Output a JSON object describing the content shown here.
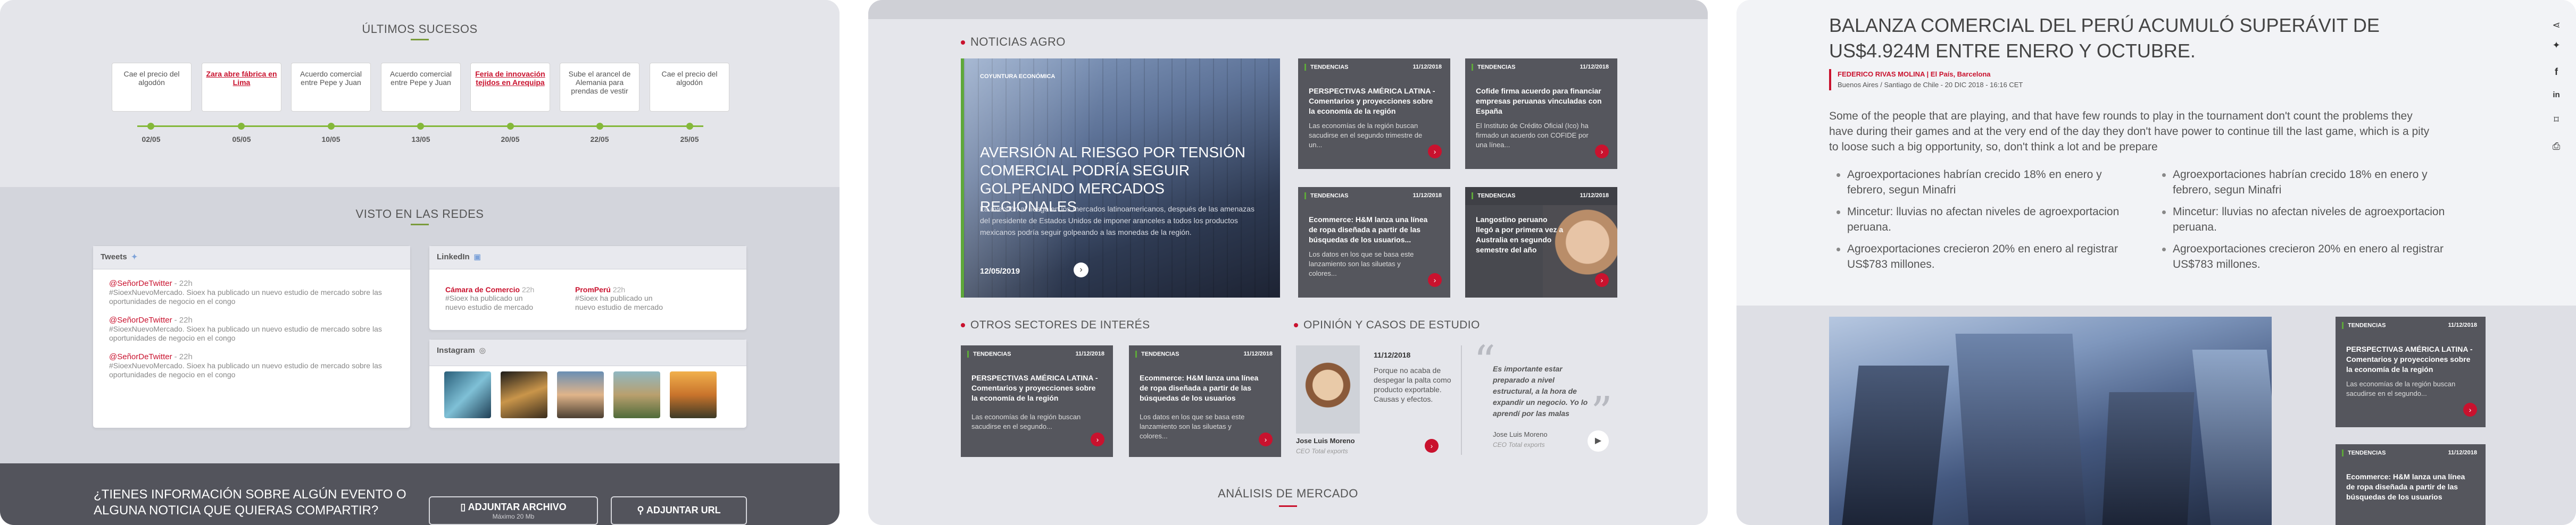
{
  "panel1": {
    "timeline_title": "ÚLTIMOS SUCESOS",
    "events": [
      {
        "label": "Cae el precio del algodón",
        "date": "02/05",
        "highlight": false
      },
      {
        "label": "Zara abre fábrica en Lima",
        "date": "05/05",
        "highlight": true
      },
      {
        "label": "Acuerdo comercial entre Pepe y Juan",
        "date": "10/05",
        "highlight": false
      },
      {
        "label": "Acuerdo comercial entre Pepe y Juan",
        "date": "13/05",
        "highlight": false
      },
      {
        "label": "Feria de innovación tejidos en Arequipa",
        "date": "20/05",
        "highlight": true
      },
      {
        "label": "Sube el arancel de Alemania para prendas de vestir",
        "date": "22/05",
        "highlight": false
      },
      {
        "label": "Cae el precio del algodón",
        "date": "25/05",
        "highlight": false
      }
    ],
    "social_title": "VISTO EN LAS REDES",
    "tweets": {
      "header": "Tweets",
      "items": [
        {
          "handle": "@SeñorDeTwitter",
          "time": "- 22h",
          "text": "#SioexNuevoMercado. Sioex ha publicado un nuevo estudio de mercado sobre las oportunidades de negocio en el congo"
        },
        {
          "handle": "@SeñorDeTwitter",
          "time": "- 22h",
          "text": "#SioexNuevoMercado. Sioex ha publicado un nuevo estudio de mercado sobre las oportunidades de negocio en el congo"
        },
        {
          "handle": "@SeñorDeTwitter",
          "time": "- 22h",
          "text": "#SioexNuevoMercado. Sioex ha publicado un nuevo estudio de mercado sobre las oportunidades de negocio en el congo"
        }
      ]
    },
    "linkedin": {
      "header": "LinkedIn",
      "items": [
        {
          "name": "Cámara de Comercio",
          "time": "22h",
          "text": "#Sioex ha publicado un nuevo estudio de mercado"
        },
        {
          "name": "PromPerú",
          "time": "22h",
          "text": "#Sioex ha publicado un nuevo estudio de mercado"
        }
      ]
    },
    "instagram": {
      "header": "Instagram"
    },
    "cta_question": "¿TIENES INFORMACIÓN SOBRE ALGÚN EVENTO O ALGUNA NOTICIA QUE QUIERAS COMPARTIR?",
    "btn_file": "ADJUNTAR ARCHIVO",
    "btn_file_sub": "Máximo 20 Mb",
    "btn_url": "ADJUNTAR URL"
  },
  "panel2": {
    "sec_agro": "NOTICIAS AGRO",
    "hero": {
      "tag": "COYUNTURA ECONÓMICA",
      "title": "AVERSIÓN AL RIESGO POR TENSIÓN COMERCIAL PODRÍA SEGUIR GOLPEANDO MERCADOS REGIONALES",
      "text": "La aversión al riesgo en los mercados latinoamericanos, después de las amenazas del presidente de Estados Unidos de imponer aranceles a todos los productos mexicanos podría seguir golpeando a las monedas de la región.",
      "date": "12/05/2019"
    },
    "cards": [
      {
        "tag": "TENDENCIAS",
        "date": "11/12/2018",
        "title": "PERSPECTIVAS AMÉRICA LATINA - Comentarios y proyecciones sobre la economía de la región",
        "body": "Las economías de la región buscan sacudirse en el segundo trimestre de un..."
      },
      {
        "tag": "TENDENCIAS",
        "date": "11/12/2018",
        "title": "Cofide firma acuerdo para financiar empresas peruanas vinculadas con España",
        "body": "El Instituto de Crédito Oficial (Ico) ha firmado un acuerdo con COFIDE por una línea..."
      },
      {
        "tag": "TENDENCIAS",
        "date": "11/12/2018",
        "title": "Ecommerce: H&M lanza una línea de ropa diseñada a partir de las búsquedas de los usuarios...",
        "body": "Los datos en los que se basa este lanzamiento son las siluetas y colores..."
      },
      {
        "tag": "TENDENCIAS",
        "date": "11/12/2018",
        "title": "Langostino peruano llegó a por primera vez a Australia en segundo semestre del año",
        "body": ""
      }
    ],
    "sec_otros": "OTROS SECTORES DE INTERÉS",
    "otros_cards": [
      {
        "tag": "TENDENCIAS",
        "date": "11/12/2018",
        "title": "PERSPECTIVAS AMÉRICA LATINA - Comentarios y proyecciones sobre la economía de la región",
        "body": "Las economías de la región buscan sacudirse en el segundo..."
      },
      {
        "tag": "TENDENCIAS",
        "date": "11/12/2018",
        "title": "Ecommerce: H&M lanza una línea de ropa diseñada a partir de las búsquedas de los usuarios",
        "body": "Los datos en los que se basa este lanzamiento son las siluetas y colores..."
      }
    ],
    "sec_opinion": "OPINIÓN Y CASOS DE ESTUDIO",
    "opinion": {
      "date": "11/12/2018",
      "text": "Porque no acaba de despegar la palta como producto exportable. Causas y efectos.",
      "author": "Jose Luis Moreno",
      "role": "CEO Total exports",
      "quote": "Es importante estar preparado a nivel estructural, a la hora de expandir un negocio. Yo lo aprendí por las malas",
      "quote_author": "Jose Luis Moreno",
      "quote_role": "CEO Total exports"
    },
    "sec_analisis": "ANÁLISIS DE MERCADO"
  },
  "panel3": {
    "title": "BALANZA COMERCIAL DEL PERÚ ACUMULÓ SUPERÁVIT DE US$4.924M ENTRE ENERO Y OCTUBRE.",
    "author_line": "FEDERICO RIVAS MOLINA | El País, Barcelona",
    "place_line": "Buenos Aires / Santiago de Chile - 20 DIC 2018 - 16:16 CET",
    "lead": "Some of the people that are playing, and that have few rounds to play in the tournament don't count the problems they have during their games and at the very end of the day they don't have power to continue till the last game, which is a pity to loose such a big opportunity, so, don't think a lot and be prepare",
    "bullets_left": [
      "Agroexportaciones habrían crecido 18% en enero y febrero, segun Minafri",
      "Mincetur: lluvias no afectan niveles de agroexportacion peruana.",
      "Agroexportaciones crecieron 20% en enero al registrar US$783 millones."
    ],
    "bullets_right": [
      "Agroexportaciones habrían crecido 18% en enero y febrero, segun Minafri",
      "Mincetur: lluvias no afectan niveles de agroexportacion peruana.",
      "Agroexportaciones crecieron 20% en enero al registrar US$783 millones."
    ],
    "side_cards": [
      {
        "tag": "TENDENCIAS",
        "date": "11/12/2018",
        "title": "PERSPECTIVAS AMÉRICA LATINA - Comentarios y proyecciones sobre la economía de la región",
        "body": "Las economías de la región buscan sacudirse en el segundo..."
      },
      {
        "tag": "TENDENCIAS",
        "date": "11/12/2018",
        "title": "Ecommerce: H&M lanza una línea de ropa diseñada a partir de las búsquedas de los usuarios",
        "body": ""
      }
    ]
  },
  "colors": {
    "accent_red": "#c9122e",
    "accent_green": "#84b83a",
    "dark_card": "#55565d"
  }
}
